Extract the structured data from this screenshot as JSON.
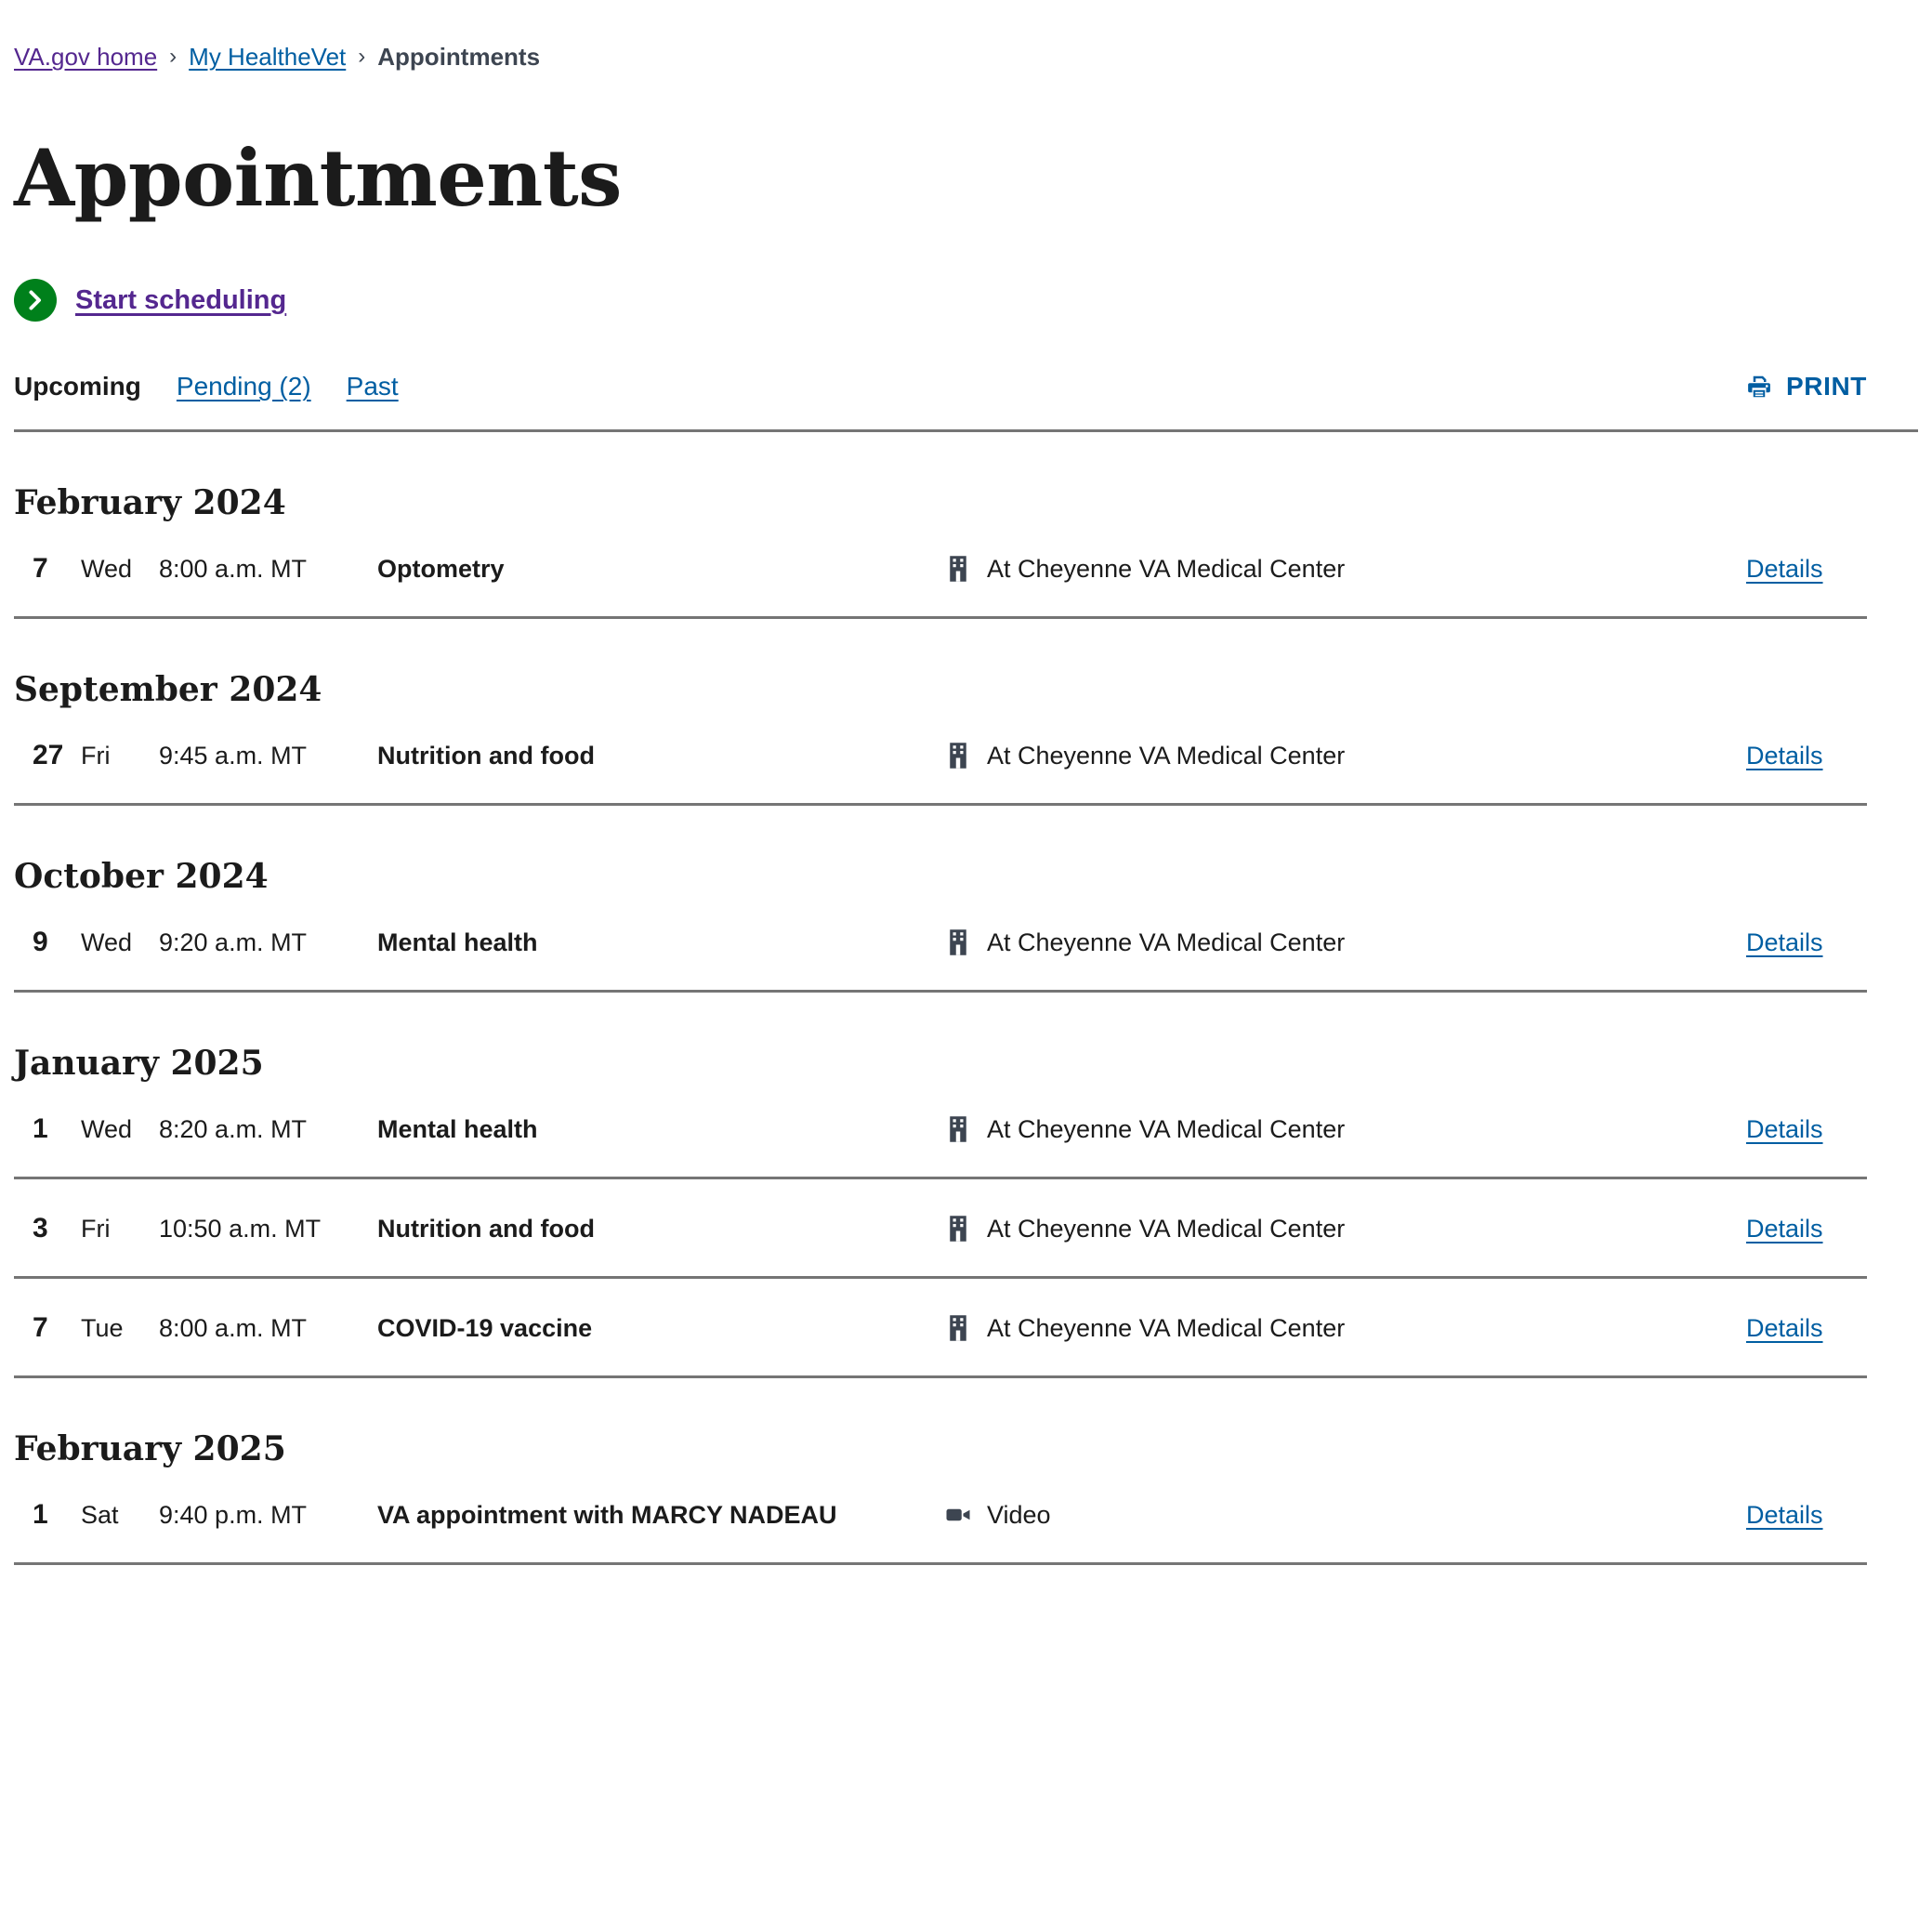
{
  "breadcrumb": {
    "items": [
      {
        "label": "VA.gov home",
        "state": "visited"
      },
      {
        "label": "My HealtheVet",
        "state": "link"
      },
      {
        "label": "Appointments",
        "state": "current"
      }
    ],
    "separator": "›"
  },
  "header": {
    "title": "Appointments"
  },
  "actions": {
    "start_scheduling_label": "Start scheduling",
    "print_label": "PRINT"
  },
  "tabs": [
    {
      "label": "Upcoming",
      "active": true
    },
    {
      "label": "Pending (2)",
      "active": false
    },
    {
      "label": "Past",
      "active": false
    }
  ],
  "colors": {
    "link_blue": "#005ea2",
    "visited_purple": "#54278f",
    "green": "#00801b",
    "icon_slate": "#3d4551",
    "divider_gray": "#757575",
    "text": "#1b1b1b"
  },
  "details_label": "Details",
  "groups": [
    {
      "month": "February 2024",
      "appointments": [
        {
          "day": "7",
          "weekday": "Wed",
          "time": "8:00 a.m. MT",
          "type": "Optometry",
          "location": "At Cheyenne VA Medical Center",
          "location_icon": "building-icon",
          "details": "Details"
        }
      ]
    },
    {
      "month": "September 2024",
      "appointments": [
        {
          "day": "27",
          "weekday": "Fri",
          "time": "9:45 a.m. MT",
          "type": "Nutrition and food",
          "location": "At Cheyenne VA Medical Center",
          "location_icon": "building-icon",
          "details": "Details"
        }
      ]
    },
    {
      "month": "October 2024",
      "appointments": [
        {
          "day": "9",
          "weekday": "Wed",
          "time": "9:20 a.m. MT",
          "type": "Mental health",
          "location": "At Cheyenne VA Medical Center",
          "location_icon": "building-icon",
          "details": "Details"
        }
      ]
    },
    {
      "month": "January 2025",
      "appointments": [
        {
          "day": "1",
          "weekday": "Wed",
          "time": "8:20 a.m. MT",
          "type": "Mental health",
          "location": "At Cheyenne VA Medical Center",
          "location_icon": "building-icon",
          "details": "Details"
        },
        {
          "day": "3",
          "weekday": "Fri",
          "time": "10:50 a.m. MT",
          "type": "Nutrition and food",
          "location": "At Cheyenne VA Medical Center",
          "location_icon": "building-icon",
          "details": "Details"
        },
        {
          "day": "7",
          "weekday": "Tue",
          "time": "8:00 a.m. MT",
          "type": "COVID-19 vaccine",
          "location": "At Cheyenne VA Medical Center",
          "location_icon": "building-icon",
          "details": "Details"
        }
      ]
    },
    {
      "month": "February 2025",
      "appointments": [
        {
          "day": "1",
          "weekday": "Sat",
          "time": "9:40 p.m. MT",
          "type": "VA appointment with MARCY NADEAU",
          "location": "Video",
          "location_icon": "video-camera-icon",
          "details": "Details"
        }
      ]
    }
  ]
}
